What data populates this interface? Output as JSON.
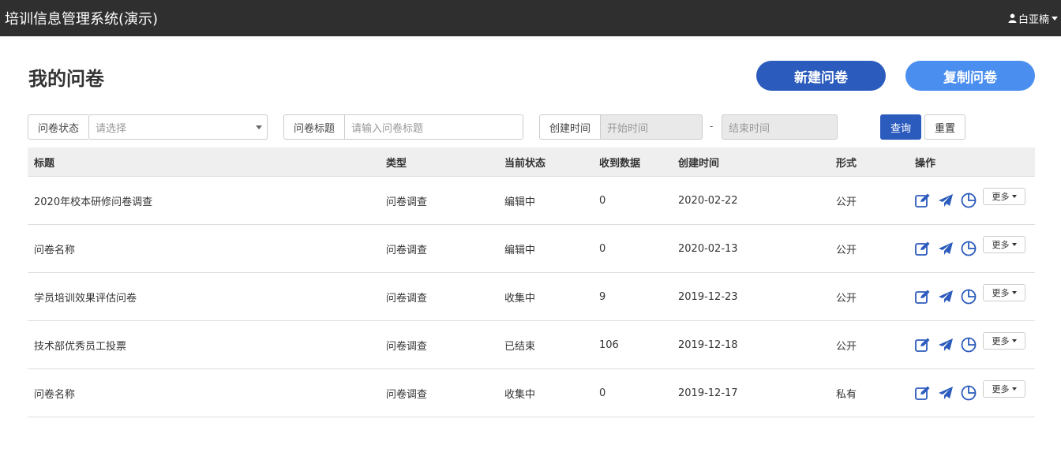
{
  "header": {
    "app_title": "培训信息管理系统(演示)",
    "user_name": "白亚楠"
  },
  "page": {
    "title": "我的问卷",
    "new_button": "新建问卷",
    "copy_button": "复制问卷"
  },
  "filters": {
    "status_label": "问卷状态",
    "status_placeholder": "请选择",
    "title_label": "问卷标题",
    "title_placeholder": "请输入问卷标题",
    "time_label": "创建时间",
    "start_placeholder": "开始时间",
    "separator": "-",
    "end_placeholder": "结束时间",
    "query_button": "查询",
    "reset_button": "重置"
  },
  "table": {
    "columns": [
      "标题",
      "类型",
      "当前状态",
      "收到数据",
      "创建时间",
      "形式",
      "操作"
    ],
    "more_label": "更多",
    "rows": [
      {
        "title": "2020年校本研修问卷调查",
        "type": "问卷调查",
        "status": "编辑中",
        "count": "0",
        "date": "2020-02-22",
        "form": "公开"
      },
      {
        "title": "问卷名称",
        "type": "问卷调查",
        "status": "编辑中",
        "count": "0",
        "date": "2020-02-13",
        "form": "公开"
      },
      {
        "title": "学员培训效果评估问卷",
        "type": "问卷调查",
        "status": "收集中",
        "count": "9",
        "date": "2019-12-23",
        "form": "公开"
      },
      {
        "title": "技术部优秀员工投票",
        "type": "问卷调查",
        "status": "已结束",
        "count": "106",
        "date": "2019-12-18",
        "form": "公开"
      },
      {
        "title": "问卷名称",
        "type": "问卷调查",
        "status": "收集中",
        "count": "0",
        "date": "2019-12-17",
        "form": "私有"
      }
    ]
  },
  "colors": {
    "topbar": "#2f2f2f",
    "primary": "#2b5bbd",
    "secondary": "#4a8ef0",
    "icon": "#2b5bbd"
  }
}
